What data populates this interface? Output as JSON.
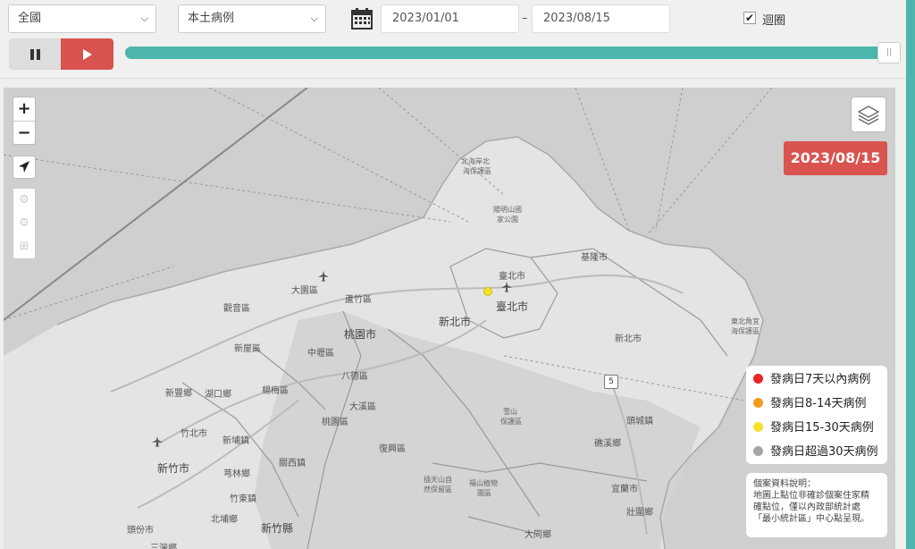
{
  "filters": {
    "region": "全國",
    "case_type": "本土病例",
    "start_date": "2023/01/01",
    "separator": "–",
    "end_date": "2023/08/15",
    "loop_label": "迴圈",
    "loop_checked": true
  },
  "playback": {
    "progress_percent": 100
  },
  "map": {
    "current_date": "2023/08/15",
    "labels": {
      "taipei_city_1": "臺北市",
      "taipei_city_2": "臺北市",
      "new_taipei_1": "新北市",
      "new_taipei_2": "新北市",
      "taoyuan_city": "桃園市",
      "keelung_city": "基隆市",
      "taoyuan_district": "桃園區",
      "dayuan": "大園區",
      "luzhu": "蘆竹區",
      "guanyin": "觀音區",
      "xinwu": "新屋區",
      "zhongli": "中壢區",
      "bade": "八德區",
      "yangmei": "楊梅區",
      "xinfeng": "新豐鄉",
      "hukou": "湖口鄉",
      "daxi": "大溪區",
      "fuxing": "復興區",
      "zhubei": "竹北市",
      "xinpu": "新埔鎮",
      "guanxi": "關西鎮",
      "hsinchu_city": "新竹市",
      "qionglin": "芎林鄉",
      "zhudong": "竹東鎮",
      "beipu": "北埔鄉",
      "hsinchu_county": "新竹縣",
      "toufen": "頭份市",
      "sanwan": "三灣鄉",
      "toucheng": "頭城鎮",
      "jiaoxi": "礁溪鄉",
      "yilan_city": "宜蘭市",
      "zhuangwei": "壯圍鄉",
      "wulu": "五股",
      "north_coast": "北海岸北",
      "north_coast2": "海保護區",
      "yangming1": "陽明山國",
      "yangming2": "家公園",
      "northeast1": "東北角宜",
      "northeast2": "海保護區",
      "highway": "5",
      "chinese1": "雪山",
      "chinese2": "保護區",
      "upper_ba1": "插天山自",
      "upper_ba2": "然保留區",
      "fushan1": "福山植物",
      "fushan2": "園區",
      "sanxing": "三星鄉",
      "datong": "大同鄉"
    }
  },
  "legend": {
    "items": [
      {
        "label": "發病日7天以內病例",
        "color": "#e8252b"
      },
      {
        "label": "發病日8-14天病例",
        "color": "#f39a21"
      },
      {
        "label": "發病日15-30天病例",
        "color": "#f5e12c"
      },
      {
        "label": "發病日超過30天病例",
        "color": "#a6a6a6"
      }
    ]
  },
  "note": {
    "lines": [
      "個案資料說明：",
      "地圖上點位非確診個案住家精",
      "確點位，僅以內政部統計處",
      "「最小統計區」中心點呈現。"
    ]
  },
  "icons": {
    "calendar": "calendar-icon",
    "pause": "pause-icon",
    "play": "play-icon",
    "locate": "locate-arrow-icon",
    "layers": "layers-icon"
  }
}
